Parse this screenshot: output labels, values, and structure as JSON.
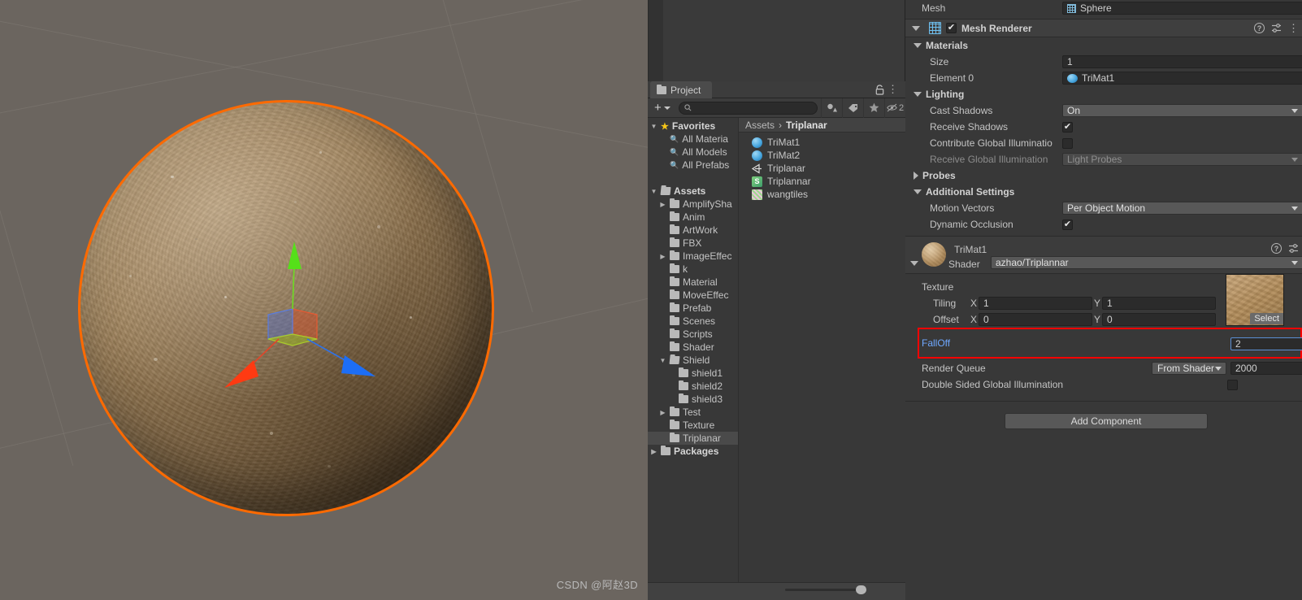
{
  "scene": {
    "watermark": "CSDN @阿赵3D",
    "selection_outline_color": "#ff6a00",
    "background_color": "#6b655f",
    "gizmo": {
      "type": "move-gizmo",
      "axis_x_color": "#ff2d17",
      "axis_y_color": "#5aff1f",
      "axis_z_color": "#1f7bff"
    },
    "object": "Sphere"
  },
  "project": {
    "tab_label": "Project",
    "search_placeholder": "",
    "plus_label": "+",
    "icons": {
      "lock": "lock-icon",
      "menu": "⋮",
      "search": "search-icon",
      "filter_type": "type-filter-icon",
      "filter_label": "label-filter-icon",
      "filter_favorite": "favorite-filter-icon",
      "hidden_count": "2"
    },
    "tree": [
      {
        "label": "Favorites",
        "depth": 0,
        "arrow": "down",
        "icon": "star",
        "bold": true
      },
      {
        "label": "All Materia",
        "depth": 1,
        "arrow": "none",
        "icon": "search",
        "bold": false
      },
      {
        "label": "All Models",
        "depth": 1,
        "arrow": "none",
        "icon": "search",
        "bold": false
      },
      {
        "label": "All Prefabs",
        "depth": 1,
        "arrow": "none",
        "icon": "search",
        "bold": false
      },
      {
        "label": "",
        "depth": 0,
        "arrow": "none",
        "icon": "none",
        "bold": false
      },
      {
        "label": "Assets",
        "depth": 0,
        "arrow": "down",
        "icon": "folder-open",
        "bold": true
      },
      {
        "label": "AmplifySha",
        "depth": 1,
        "arrow": "right",
        "icon": "folder",
        "bold": false
      },
      {
        "label": "Anim",
        "depth": 1,
        "arrow": "none",
        "icon": "folder",
        "bold": false
      },
      {
        "label": "ArtWork",
        "depth": 1,
        "arrow": "none",
        "icon": "folder",
        "bold": false
      },
      {
        "label": "FBX",
        "depth": 1,
        "arrow": "none",
        "icon": "folder",
        "bold": false
      },
      {
        "label": "ImageEffec",
        "depth": 1,
        "arrow": "right",
        "icon": "folder",
        "bold": false
      },
      {
        "label": "k",
        "depth": 1,
        "arrow": "none",
        "icon": "folder",
        "bold": false
      },
      {
        "label": "Material",
        "depth": 1,
        "arrow": "none",
        "icon": "folder",
        "bold": false
      },
      {
        "label": "MoveEffec",
        "depth": 1,
        "arrow": "none",
        "icon": "folder",
        "bold": false
      },
      {
        "label": "Prefab",
        "depth": 1,
        "arrow": "none",
        "icon": "folder",
        "bold": false
      },
      {
        "label": "Scenes",
        "depth": 1,
        "arrow": "none",
        "icon": "folder",
        "bold": false
      },
      {
        "label": "Scripts",
        "depth": 1,
        "arrow": "none",
        "icon": "folder",
        "bold": false
      },
      {
        "label": "Shader",
        "depth": 1,
        "arrow": "none",
        "icon": "folder",
        "bold": false
      },
      {
        "label": "Shield",
        "depth": 1,
        "arrow": "down",
        "icon": "folder-open",
        "bold": false
      },
      {
        "label": "shield1",
        "depth": 2,
        "arrow": "none",
        "icon": "folder",
        "bold": false
      },
      {
        "label": "shield2",
        "depth": 2,
        "arrow": "none",
        "icon": "folder",
        "bold": false
      },
      {
        "label": "shield3",
        "depth": 2,
        "arrow": "none",
        "icon": "folder",
        "bold": false
      },
      {
        "label": "Test",
        "depth": 1,
        "arrow": "right",
        "icon": "folder",
        "bold": false
      },
      {
        "label": "Texture",
        "depth": 1,
        "arrow": "none",
        "icon": "folder",
        "bold": false
      },
      {
        "label": "Triplanar",
        "depth": 1,
        "arrow": "none",
        "icon": "folder",
        "bold": false,
        "selected": true
      },
      {
        "label": "Packages",
        "depth": 0,
        "arrow": "right",
        "icon": "folder",
        "bold": true
      }
    ],
    "breadcrumb": {
      "root": "Assets",
      "separator": "›",
      "current": "Triplanar"
    },
    "assets": [
      {
        "label": "TriMat1",
        "icon": "material-icon"
      },
      {
        "label": "TriMat2",
        "icon": "material-icon"
      },
      {
        "label": "Triplanar",
        "icon": "shader-icon"
      },
      {
        "label": "Triplannar",
        "icon": "script-icon"
      },
      {
        "label": "wangtiles",
        "icon": "texture-icon"
      }
    ]
  },
  "inspector": {
    "mesh_row": {
      "label": "Mesh",
      "value": "Sphere"
    },
    "mesh_renderer": {
      "title": "Mesh Renderer",
      "enabled": true,
      "sections": {
        "materials": {
          "title": "Materials",
          "size": {
            "label": "Size",
            "value": "1"
          },
          "element0": {
            "label": "Element 0",
            "value": "TriMat1"
          }
        },
        "lighting": {
          "title": "Lighting",
          "cast_shadows": {
            "label": "Cast Shadows",
            "value": "On"
          },
          "receive_shadows": {
            "label": "Receive Shadows",
            "checked": true
          },
          "contribute_gi": {
            "label": "Contribute Global Illuminatio",
            "checked": false
          },
          "receive_gi": {
            "label": "Receive Global Illumination",
            "value": "Light Probes"
          }
        },
        "probes": {
          "title": "Probes"
        },
        "additional": {
          "title": "Additional Settings",
          "motion_vectors": {
            "label": "Motion Vectors",
            "value": "Per Object Motion"
          },
          "dynamic_occlusion": {
            "label": "Dynamic Occlusion",
            "checked": true
          }
        }
      }
    },
    "material": {
      "name": "TriMat1",
      "shader_label": "Shader",
      "shader_value": "azhao/Triplannar",
      "texture_label": "Texture",
      "select_button": "Select",
      "tiling": {
        "label": "Tiling",
        "x_label": "X",
        "x": "1",
        "y_label": "Y",
        "y": "1"
      },
      "offset": {
        "label": "Offset",
        "x_label": "X",
        "x": "0",
        "y_label": "Y",
        "y": "0"
      },
      "falloff": {
        "label": "FallOff",
        "value": "2",
        "highlight_color": "#ff0000"
      },
      "render_queue": {
        "label": "Render Queue",
        "mode": "From Shader",
        "value": "2000"
      },
      "double_sided_gi": {
        "label": "Double Sided Global Illumination",
        "checked": false
      }
    },
    "add_component": "Add Component"
  }
}
